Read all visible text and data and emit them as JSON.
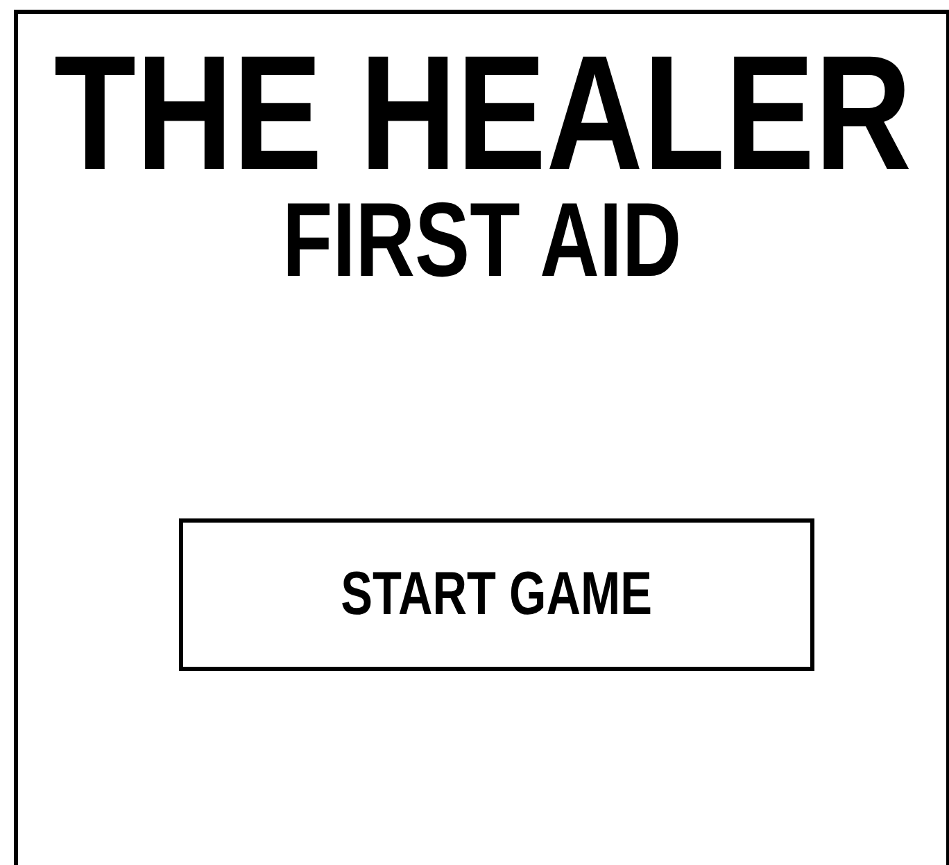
{
  "title": "THE HEALER",
  "subtitle": "FIRST AID",
  "buttons": [
    {
      "label": "START GAME"
    }
  ]
}
